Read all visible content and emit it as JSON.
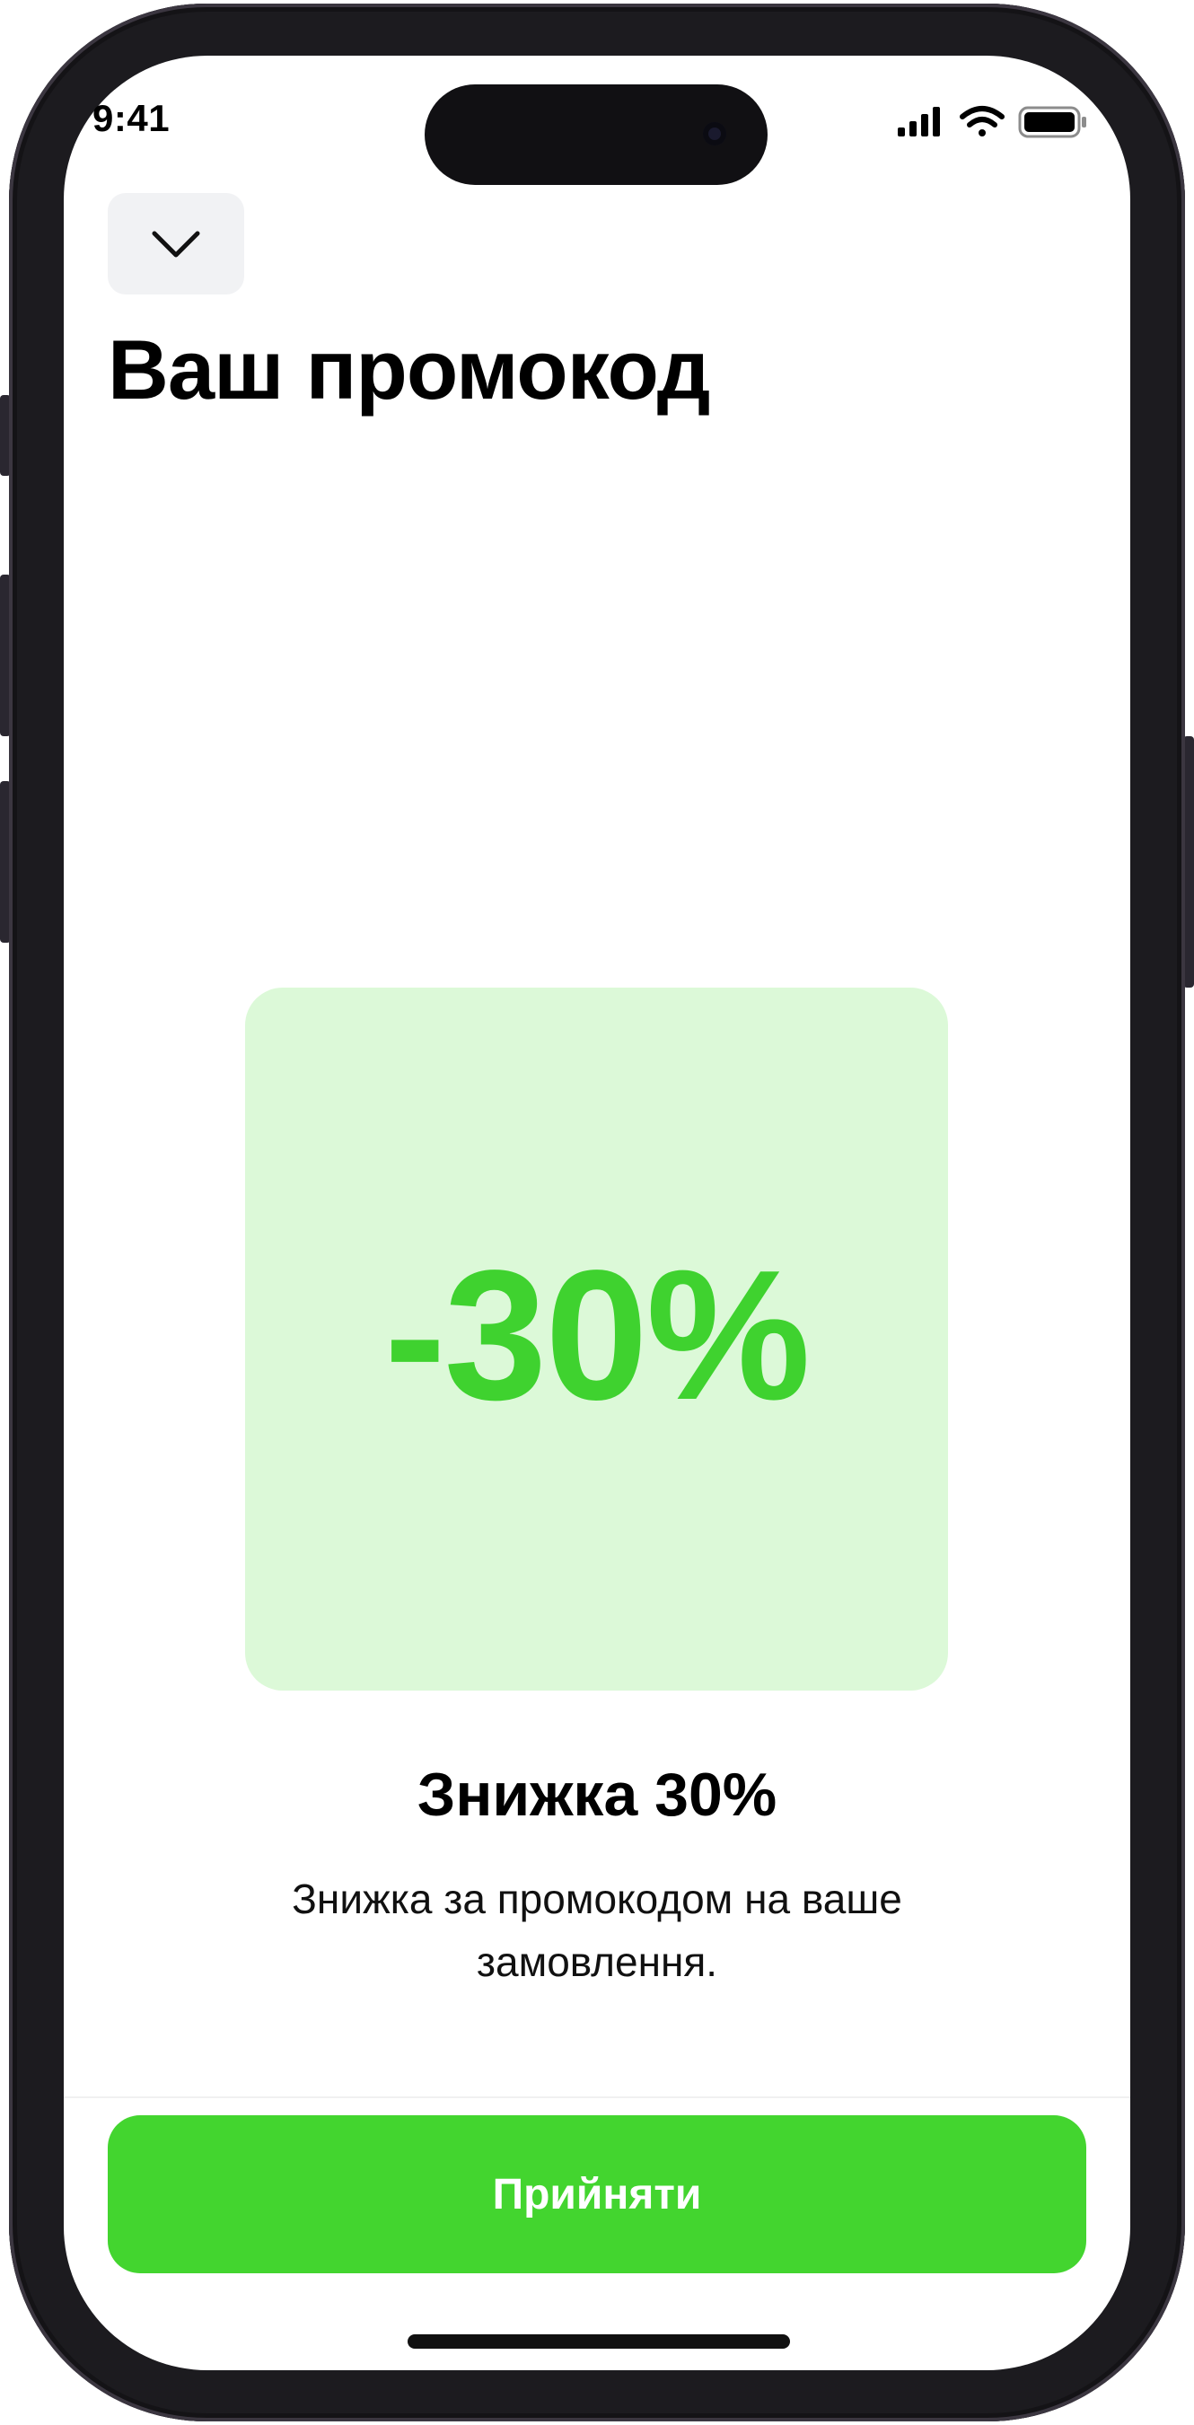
{
  "status_bar": {
    "time": "9:41"
  },
  "header": {
    "close_icon": "chevron-down-icon",
    "title": "Ваш промокод"
  },
  "promo": {
    "value": "-30%",
    "card_color": "#dcf9d8",
    "value_color": "#3fd22f"
  },
  "details": {
    "title": "Знижка 30%",
    "description": "Знижка за промокодом на ваше замовлення."
  },
  "actions": {
    "accept_label": "Прийняти",
    "accept_color": "#43d52f"
  },
  "icons": {
    "signal": "cellular-signal-icon",
    "wifi": "wifi-icon",
    "battery": "battery-icon"
  }
}
